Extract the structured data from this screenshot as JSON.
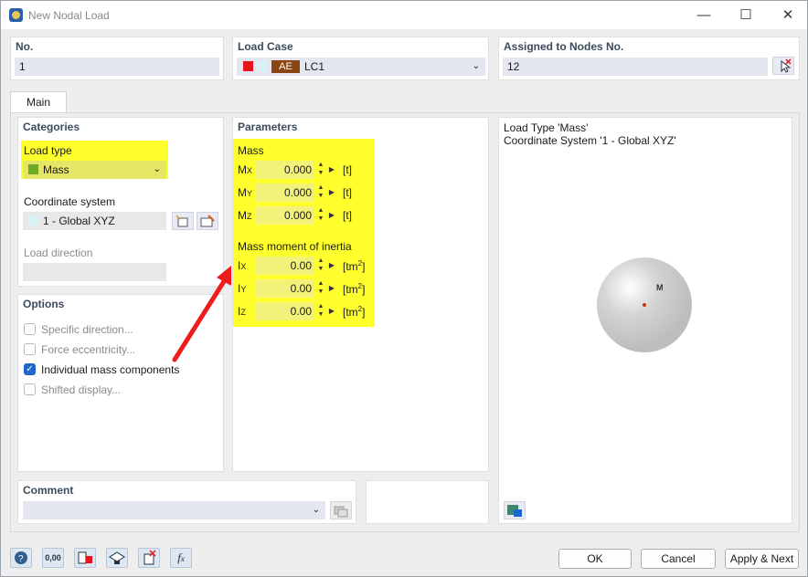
{
  "window": {
    "title": "New Nodal Load",
    "minimize": "—",
    "maximize": "☐",
    "close": "✕"
  },
  "header": {
    "no_label": "No.",
    "no_value": "1",
    "loadcase_label": "Load Case",
    "loadcase_tag": "AE",
    "loadcase_name": "LC1",
    "nodes_label": "Assigned to Nodes No.",
    "nodes_value": "12"
  },
  "tabs": {
    "main": "Main"
  },
  "categories": {
    "title": "Categories",
    "load_type_label": "Load type",
    "load_type_value": "Mass",
    "coord_label": "Coordinate system",
    "coord_value": "1 - Global XYZ",
    "direction_label": "Load direction"
  },
  "options": {
    "title": "Options",
    "items": [
      {
        "label": "Specific direction...",
        "checked": false
      },
      {
        "label": "Force eccentricity...",
        "checked": false
      },
      {
        "label": "Individual mass components",
        "checked": true
      },
      {
        "label": "Shifted display...",
        "checked": false
      }
    ]
  },
  "parameters": {
    "title": "Parameters",
    "mass_heading": "Mass",
    "mass": [
      {
        "sym": "M",
        "sub": "X",
        "value": "0.000",
        "unit": "[t]"
      },
      {
        "sym": "M",
        "sub": "Y",
        "value": "0.000",
        "unit": "[t]"
      },
      {
        "sym": "M",
        "sub": "Z",
        "value": "0.000",
        "unit": "[t]"
      }
    ],
    "inertia_heading": "Mass moment of inertia",
    "inertia": [
      {
        "sym": "I",
        "sub": "X",
        "value": "0.00",
        "unit": "[tm",
        "sup": "2",
        "close": "]"
      },
      {
        "sym": "I",
        "sub": "Y",
        "value": "0.00",
        "unit": "[tm",
        "sup": "2",
        "close": "]"
      },
      {
        "sym": "I",
        "sub": "Z",
        "value": "0.00",
        "unit": "[tm",
        "sup": "2",
        "close": "]"
      }
    ]
  },
  "preview": {
    "line1": "Load Type 'Mass'",
    "line2": "Coordinate System '1 - Global XYZ'",
    "sphere_label": "M"
  },
  "comment": {
    "title": "Comment"
  },
  "buttons": {
    "ok": "OK",
    "cancel": "Cancel",
    "apply_next": "Apply & Next"
  },
  "toolbar": {
    "units_label": "0,00"
  },
  "colors": {
    "highlight": "#ffff2e",
    "loadcase_red": "#e8141b",
    "loadcase_tag": "#8b4513",
    "mass_green": "#6aaa26",
    "arrow": "#ee1c1c",
    "accent": "#1e66c9"
  }
}
